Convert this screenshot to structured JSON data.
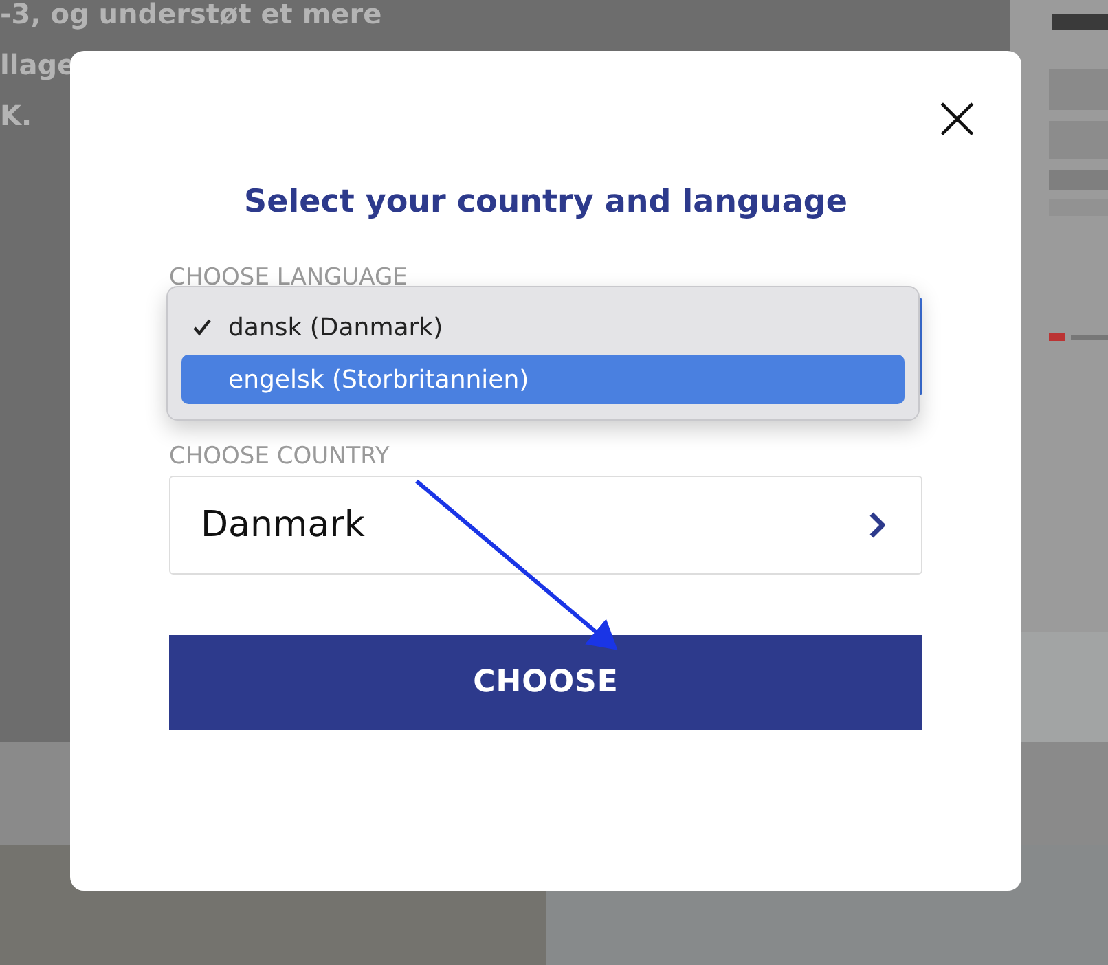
{
  "background_page": {
    "text_lines": [
      "-3, og understøt et mere",
      "llage",
      "K."
    ]
  },
  "dialog": {
    "close_label": "×",
    "title": "Select your country and language",
    "language": {
      "label": "CHOOSE LANGUAGE",
      "options": [
        {
          "label": "dansk (Danmark)",
          "checked": true,
          "highlighted": false
        },
        {
          "label": "engelsk (Storbritannien)",
          "checked": false,
          "highlighted": true
        }
      ]
    },
    "country": {
      "label": "CHOOSE COUNTRY",
      "value": "Danmark"
    },
    "button": "CHOOSE"
  }
}
